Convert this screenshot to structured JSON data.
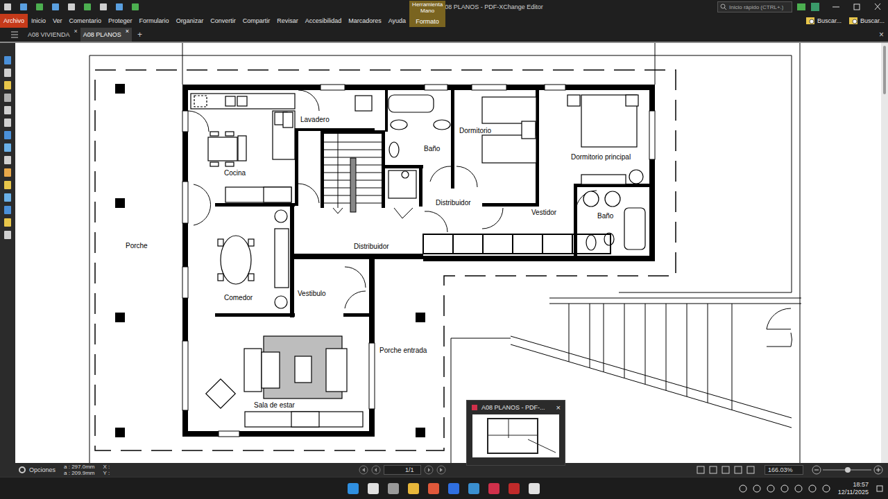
{
  "window": {
    "title": "A08 PLANOS - PDF-XChange Editor"
  },
  "quick_search": {
    "placeholder": "Inicio rápido (CTRL+.)"
  },
  "menu": [
    {
      "label": "Archivo",
      "selected": true
    },
    {
      "label": "Inicio",
      "selected": false
    },
    {
      "label": "Ver",
      "selected": false
    },
    {
      "label": "Comentario",
      "selected": false
    },
    {
      "label": "Proteger",
      "selected": false
    },
    {
      "label": "Formulario",
      "selected": false
    },
    {
      "label": "Organizar",
      "selected": false
    },
    {
      "label": "Convertir",
      "selected": false
    },
    {
      "label": "Compartir",
      "selected": false
    },
    {
      "label": "Revisar",
      "selected": false
    },
    {
      "label": "Accesibilidad",
      "selected": false
    },
    {
      "label": "Marcadores",
      "selected": false
    },
    {
      "label": "Ayuda",
      "selected": false
    }
  ],
  "context_tab": {
    "group": "Herramienta Mano",
    "label": "Formato"
  },
  "ribbon_right": [
    "Buscar...",
    "Buscar..."
  ],
  "tabs": [
    {
      "label": "A08 VIVIENDA",
      "selected": false,
      "close": "×"
    },
    {
      "label": "A08 PLANOS",
      "selected": true,
      "close": "×"
    }
  ],
  "new_tab": "+",
  "close_doc": "×",
  "rooms": [
    {
      "label": "Lavadero"
    },
    {
      "label": "Baño"
    },
    {
      "label": "Dormitorio"
    },
    {
      "label": "Dormitorio principal"
    },
    {
      "label": "Cocina"
    },
    {
      "label": "Distribuidor"
    },
    {
      "label": "Vestidor"
    },
    {
      "label": "Baño"
    },
    {
      "label": "Porche"
    },
    {
      "label": "Distribuidor"
    },
    {
      "label": "Comedor"
    },
    {
      "label": "Vestibulo"
    },
    {
      "label": "Porche entrada"
    },
    {
      "label": "Sala de estar"
    }
  ],
  "status_bar": {
    "options": "Opciones",
    "width": "a : 297.0mm",
    "height": "a : 209.9mm",
    "x": "X :",
    "y": "Y :",
    "page": "1/1",
    "zoom": "166.03%"
  },
  "preview": {
    "title": "A08 PLANOS - PDF-...",
    "close": "×"
  },
  "taskbar": {
    "time": "18:57",
    "date": "12/11/2025"
  }
}
